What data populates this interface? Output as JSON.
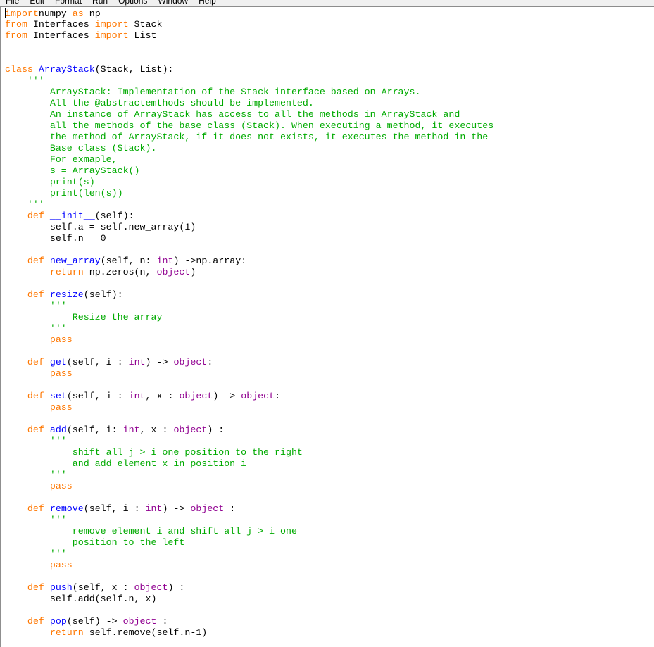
{
  "menu": [
    "File",
    "Edit",
    "Format",
    "Run",
    "Options",
    "Window",
    "Help"
  ],
  "colors": {
    "keyword": "#ff7700",
    "definition": "#0000ff",
    "builtin": "#900090",
    "string": "#00aa00",
    "default": "#000000"
  },
  "code_lines": [
    [
      [
        "kw",
        "import"
      ],
      [
        "",
        "numpy "
      ],
      [
        "kw",
        "as"
      ],
      [
        "",
        " np"
      ]
    ],
    [
      [
        "kw",
        "from"
      ],
      [
        "",
        " Interfaces "
      ],
      [
        "kw",
        "import"
      ],
      [
        "",
        " Stack"
      ]
    ],
    [
      [
        "kw",
        "from"
      ],
      [
        "",
        " Interfaces "
      ],
      [
        "kw",
        "import"
      ],
      [
        "",
        " List"
      ]
    ],
    [],
    [],
    [
      [
        "kw",
        "class"
      ],
      [
        "",
        " "
      ],
      [
        "def",
        "ArrayStack"
      ],
      [
        "",
        "(Stack, List):"
      ]
    ],
    [
      [
        "",
        "    "
      ],
      [
        "str",
        "'''"
      ]
    ],
    [
      [
        "str",
        "        ArrayStack: Implementation of the Stack interface based on Arrays."
      ]
    ],
    [
      [
        "str",
        "        All the @abstractemthods should be implemented."
      ]
    ],
    [
      [
        "str",
        "        An instance of ArrayStack has access to all the methods in ArrayStack and"
      ]
    ],
    [
      [
        "str",
        "        all the methods of the base class (Stack). When executing a method, it executes"
      ]
    ],
    [
      [
        "str",
        "        the method of ArrayStack, if it does not exists, it executes the method in the"
      ]
    ],
    [
      [
        "str",
        "        Base class (Stack)."
      ]
    ],
    [
      [
        "str",
        "        For exmaple,"
      ]
    ],
    [
      [
        "str",
        "        s = ArrayStack()"
      ]
    ],
    [
      [
        "str",
        "        print(s)"
      ]
    ],
    [
      [
        "str",
        "        print(len(s))"
      ]
    ],
    [
      [
        "",
        "    "
      ],
      [
        "str",
        "'''"
      ]
    ],
    [
      [
        "",
        "    "
      ],
      [
        "kw",
        "def"
      ],
      [
        "",
        " "
      ],
      [
        "def",
        "__init__"
      ],
      [
        "",
        "(self):"
      ]
    ],
    [
      [
        "",
        "        self.a = self.new_array(1)"
      ]
    ],
    [
      [
        "",
        "        self.n = 0"
      ]
    ],
    [],
    [
      [
        "",
        "    "
      ],
      [
        "kw",
        "def"
      ],
      [
        "",
        " "
      ],
      [
        "def",
        "new_array"
      ],
      [
        "",
        "(self, n: "
      ],
      [
        "bi",
        "int"
      ],
      [
        "",
        ") ->np.array:"
      ]
    ],
    [
      [
        "",
        "        "
      ],
      [
        "kw",
        "return"
      ],
      [
        "",
        " np.zeros(n, "
      ],
      [
        "bi",
        "object"
      ],
      [
        "",
        ")"
      ]
    ],
    [],
    [
      [
        "",
        "    "
      ],
      [
        "kw",
        "def"
      ],
      [
        "",
        " "
      ],
      [
        "def",
        "resize"
      ],
      [
        "",
        "(self):"
      ]
    ],
    [
      [
        "",
        "        "
      ],
      [
        "str",
        "'''"
      ]
    ],
    [
      [
        "str",
        "            Resize the array"
      ]
    ],
    [
      [
        "",
        "        "
      ],
      [
        "str",
        "'''"
      ]
    ],
    [
      [
        "",
        "        "
      ],
      [
        "kw",
        "pass"
      ]
    ],
    [],
    [
      [
        "",
        "    "
      ],
      [
        "kw",
        "def"
      ],
      [
        "",
        " "
      ],
      [
        "def",
        "get"
      ],
      [
        "",
        "(self, i : "
      ],
      [
        "bi",
        "int"
      ],
      [
        "",
        ") -> "
      ],
      [
        "bi",
        "object"
      ],
      [
        "",
        ":"
      ]
    ],
    [
      [
        "",
        "        "
      ],
      [
        "kw",
        "pass"
      ]
    ],
    [],
    [
      [
        "",
        "    "
      ],
      [
        "kw",
        "def"
      ],
      [
        "",
        " "
      ],
      [
        "def",
        "set"
      ],
      [
        "",
        "(self, i : "
      ],
      [
        "bi",
        "int"
      ],
      [
        "",
        ", x : "
      ],
      [
        "bi",
        "object"
      ],
      [
        "",
        ") -> "
      ],
      [
        "bi",
        "object"
      ],
      [
        "",
        ":"
      ]
    ],
    [
      [
        "",
        "        "
      ],
      [
        "kw",
        "pass"
      ]
    ],
    [],
    [
      [
        "",
        "    "
      ],
      [
        "kw",
        "def"
      ],
      [
        "",
        " "
      ],
      [
        "def",
        "add"
      ],
      [
        "",
        "(self, i: "
      ],
      [
        "bi",
        "int"
      ],
      [
        "",
        ", x : "
      ],
      [
        "bi",
        "object"
      ],
      [
        "",
        ") :"
      ]
    ],
    [
      [
        "",
        "        "
      ],
      [
        "str",
        "'''"
      ]
    ],
    [
      [
        "str",
        "            shift all j > i one position to the right"
      ]
    ],
    [
      [
        "str",
        "            and add element x in position i"
      ]
    ],
    [
      [
        "",
        "        "
      ],
      [
        "str",
        "'''"
      ]
    ],
    [
      [
        "",
        "        "
      ],
      [
        "kw",
        "pass"
      ]
    ],
    [],
    [
      [
        "",
        "    "
      ],
      [
        "kw",
        "def"
      ],
      [
        "",
        " "
      ],
      [
        "def",
        "remove"
      ],
      [
        "",
        "(self, i : "
      ],
      [
        "bi",
        "int"
      ],
      [
        "",
        ") -> "
      ],
      [
        "bi",
        "object"
      ],
      [
        "",
        " :"
      ]
    ],
    [
      [
        "",
        "        "
      ],
      [
        "str",
        "'''"
      ]
    ],
    [
      [
        "str",
        "            remove element i and shift all j > i one"
      ]
    ],
    [
      [
        "str",
        "            position to the left"
      ]
    ],
    [
      [
        "",
        "        "
      ],
      [
        "str",
        "'''"
      ]
    ],
    [
      [
        "",
        "        "
      ],
      [
        "kw",
        "pass"
      ]
    ],
    [],
    [
      [
        "",
        "    "
      ],
      [
        "kw",
        "def"
      ],
      [
        "",
        " "
      ],
      [
        "def",
        "push"
      ],
      [
        "",
        "(self, x : "
      ],
      [
        "bi",
        "object"
      ],
      [
        "",
        ") :"
      ]
    ],
    [
      [
        "",
        "        self.add(self.n, x)"
      ]
    ],
    [],
    [
      [
        "",
        "    "
      ],
      [
        "kw",
        "def"
      ],
      [
        "",
        " "
      ],
      [
        "def",
        "pop"
      ],
      [
        "",
        "(self) -> "
      ],
      [
        "bi",
        "object"
      ],
      [
        "",
        " :"
      ]
    ],
    [
      [
        "",
        "        "
      ],
      [
        "kw",
        "return"
      ],
      [
        "",
        " self.remove(self.n-1)"
      ]
    ]
  ]
}
